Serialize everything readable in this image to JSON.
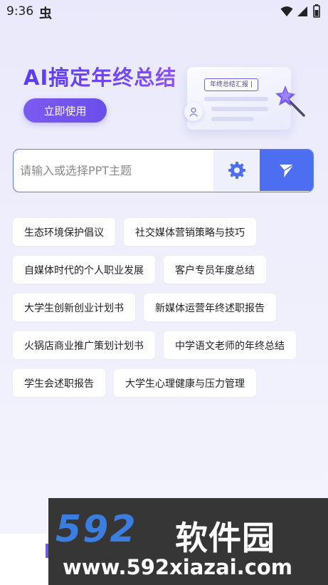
{
  "status_bar": {
    "time": "9:36",
    "app_icon": "虫",
    "icons": [
      "wifi-icon",
      "signal-icon",
      "battery-icon"
    ]
  },
  "banner": {
    "title": "AI搞定年终总结",
    "button_label": "立即使用",
    "doc_tag": "年终总结汇报",
    "accent_color": "#6b4eea"
  },
  "search": {
    "placeholder": "请输入或选择PPT主题",
    "value": "",
    "settings_icon": "gear-icon",
    "send_icon": "send-icon",
    "border_color": "#5c7cf2",
    "send_color": "#4e6ef2"
  },
  "topics": {
    "rows": [
      [
        "生态环境保护倡议",
        "社交媒体营销策略与技巧"
      ],
      [
        "自媒体时代的个人职业发展",
        "客户专员年度总结"
      ],
      [
        "大学生创新创业计划书",
        "新媒体运营年终述职报告"
      ],
      [
        "火锅店商业推广策划计划书",
        "中学语文老师的年终总结"
      ],
      [
        "学生会述职报告",
        "大学生心理健康与压力管理"
      ]
    ]
  },
  "watermark": {
    "logo": "592",
    "name": "软件园",
    "url": "www.592xiazai.com"
  }
}
